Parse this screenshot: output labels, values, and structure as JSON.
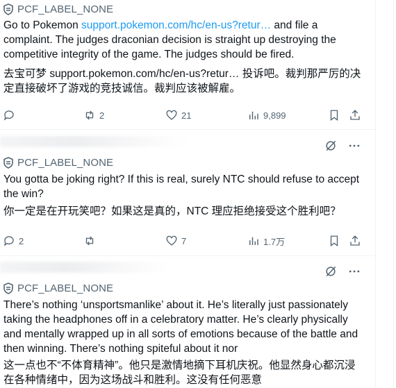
{
  "posts": [
    {
      "label": "PCF_LABEL_NONE",
      "text_before": "Go to Pokemon ",
      "link": "support.pokemon.com/hc/en-us?retur…",
      "text_after": " and file a complaint. The judges draconian decision is straight up destroying the competitive integrity of the game. The judges should be fired.",
      "trans_before": "去宝可梦 ",
      "trans_link": "support.pokemon.com/hc/en-us?retur…",
      "trans_after": " 投诉吧。裁判那严厉的决定直接破坏了游戏的竞技诚信。裁判应该被解雇。",
      "replies": "",
      "reposts": "2",
      "likes": "21",
      "views": "9,899"
    },
    {
      "label": "PCF_LABEL_NONE",
      "text": "You gotta be joking right? If this is real, surely NTC should refuse to accept the win?",
      "translation": "你一定是在开玩笑吧？如果这是真的，NTC 理应拒绝接受这个胜利吧？",
      "replies": "2",
      "reposts": "",
      "likes": "7",
      "views": "1.7万"
    },
    {
      "label": "PCF_LABEL_NONE",
      "text": "There’s nothing ‘unsportsmanlike’ about it. He’s literally just passionately taking the headphones off in a celebratory matter. He’s clearly physically and mentally wrapped up in all sorts of emotions because of the battle and then winning. There’s nothing spiteful about it nor",
      "translation": "这一点也不“不体育精神”。他只是激情地摘下耳机庆祝。他显然身心都沉浸在各种情绪中，因为这场战斗和胜利。这没有任何恶意"
    }
  ],
  "colors": {
    "link": "#1d9bf0",
    "muted": "#536471",
    "text": "#0f1419",
    "divider": "#eff3f4"
  }
}
